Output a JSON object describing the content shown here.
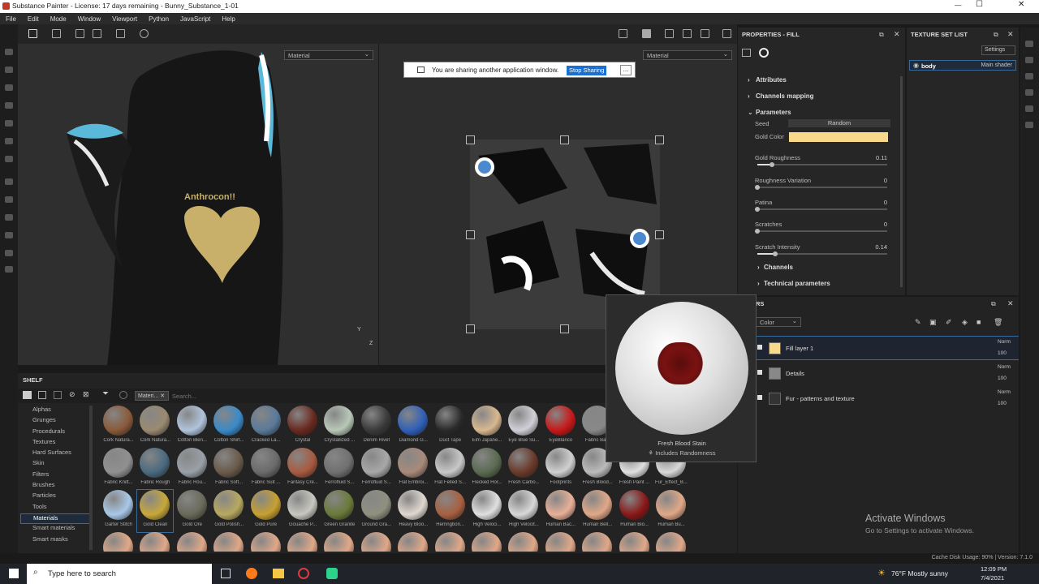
{
  "window": {
    "title": "Substance Painter - License: 17 days remaining - Bunny_Substance_1-01"
  },
  "menu": [
    "File",
    "Edit",
    "Mode",
    "Window",
    "Viewport",
    "Python",
    "JavaScript",
    "Help"
  ],
  "viewport": {
    "left_dropdown": "Material",
    "right_dropdown": "Material",
    "logo_text": "Anthrocon!!",
    "axis_y": "Y",
    "axis_z": "Z"
  },
  "sharing": {
    "message": "You are sharing another application window.",
    "stop": "Stop Sharing",
    "minimize": "..."
  },
  "properties": {
    "title": "PROPERTIES - FILL",
    "attributes": "Attributes",
    "channels_mapping": "Channels mapping",
    "parameters": "Parameters",
    "seed_label": "Seed",
    "seed_value": "Random",
    "gold_color_label": "Gold Color",
    "gold_color": "#f8d88a",
    "channels": "Channels",
    "technical": "Technical parameters",
    "params": [
      {
        "label": "Gold Roughness",
        "value": "0.11",
        "frac": 0.11
      },
      {
        "label": "Roughness Variation",
        "value": "0",
        "frac": 0
      },
      {
        "label": "Patina",
        "value": "0",
        "frac": 0
      },
      {
        "label": "Scratches",
        "value": "0",
        "frac": 0
      },
      {
        "label": "Scratch Intensity",
        "value": "0.14",
        "frac": 0.14
      }
    ]
  },
  "texture_set": {
    "title": "TEXTURE SET LIST",
    "settings": "Settings",
    "name": "body",
    "shader": "Main shader"
  },
  "layers": {
    "title": "RS",
    "blend_dropdown": "Color",
    "items": [
      {
        "name": "Fill layer 1",
        "mode": "Norm",
        "opacity": "100"
      },
      {
        "name": "Details",
        "mode": "Norm",
        "opacity": "100"
      },
      {
        "name": "Fur - patterns and texture",
        "mode": "Norm",
        "opacity": "100"
      }
    ]
  },
  "shelf": {
    "title": "SHELF",
    "filter_tag": "Materi...",
    "search_placeholder": "Search...",
    "categories": [
      "Alphas",
      "Grunges",
      "Procedurals",
      "Textures",
      "Hard Surfaces",
      "Skin",
      "Filters",
      "Brushes",
      "Particles",
      "Tools",
      "Materials",
      "Smart materials",
      "Smart masks"
    ],
    "selected_category": "Materials",
    "materials": [
      [
        "Cork Natura...",
        "Cork Natura...",
        "Cotton Blen...",
        "Cotton Shirt...",
        "Cracked La...",
        "Crystal",
        "Crystallized ...",
        "Denim Rivet",
        "Diamond G...",
        "Duct Tape",
        "Elm Japane...",
        "Eye Blue Su...",
        "EyeBlanco",
        "Fabric Ba..."
      ],
      [
        "Fabric Knitt...",
        "Fabric Rough",
        "Fabric Rou...",
        "Fabric Soft...",
        "Fabric Suit ...",
        "Fantasy Cre...",
        "Ferrofluid S...",
        "Ferrofluid S...",
        "Flat Embroi...",
        "Flat Felled S...",
        "Flecked Hor...",
        "Fresh Carbo...",
        "Footprints",
        "Fresh Blood...",
        "Fresh Paint ...",
        "Fur_Effect_B..."
      ],
      [
        "Garter Stitch",
        "Gold Clean",
        "Gold Ore",
        "Gold Polish...",
        "Gold Pure",
        "Gouache P...",
        "Green Granite",
        "Ground Gra...",
        "Heavy Bloo...",
        "Herringbon...",
        "High Veloci...",
        "High Velocit...",
        "Human Bac...",
        "Human Bell...",
        "Human Bio...",
        "Human Bu..."
      ]
    ]
  },
  "preview": {
    "name": "Fresh Blood Stain",
    "note": "Includes Randomness"
  },
  "watermark": {
    "line1": "Activate Windows",
    "line2": "Go to Settings to activate Windows."
  },
  "status": {
    "text": "Cache Disk Usage: 90% | Version: 7.1.0"
  },
  "taskbar": {
    "search": "Type here to search",
    "weather": "76°F  Mostly sunny",
    "time": "12:09 PM",
    "date": "7/4/2021"
  }
}
